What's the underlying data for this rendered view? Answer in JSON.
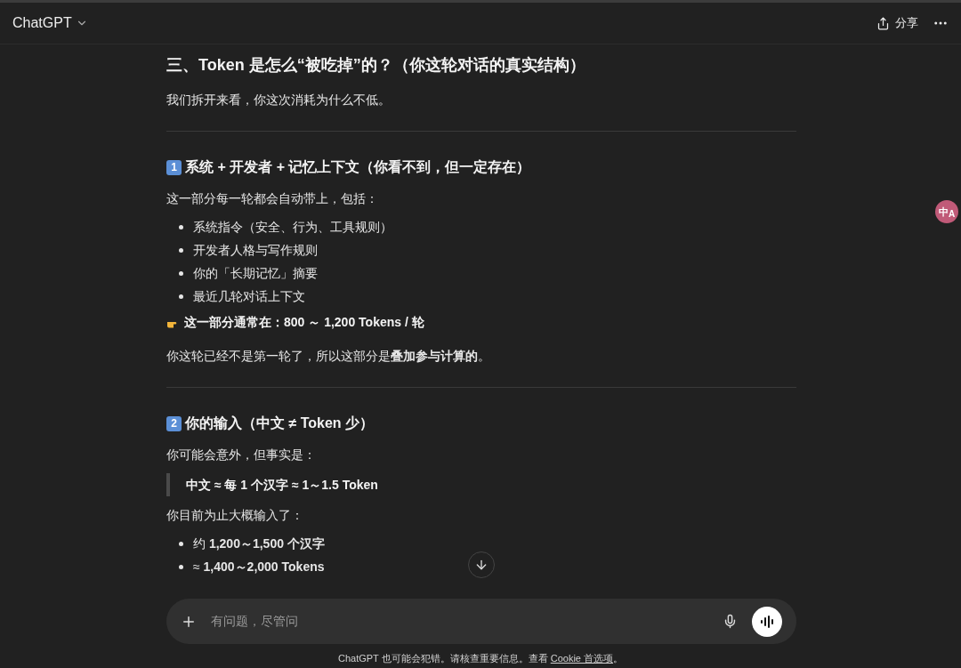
{
  "header": {
    "title": "ChatGPT",
    "share_label": "分享"
  },
  "blocks": [
    {
      "kind": "heading",
      "text": "三、Token 是怎么“被吃掉”的？（你这轮对话的真实结构）"
    },
    {
      "kind": "paragraph",
      "text": "我们拆开来看，你这次消耗为什么不低。"
    },
    {
      "kind": "divider"
    },
    {
      "kind": "subheading",
      "number": "1",
      "text": "系统 + 开发者 + 记忆上下文（你看不到，但一定存在）"
    },
    {
      "kind": "paragraph",
      "text": "这一部分每一轮都会自动带上，包括："
    },
    {
      "kind": "list",
      "items": [
        "系统指令（安全、行为、工具规则）",
        "开发者人格与写作规则",
        "你的「长期记忆」摘要",
        "最近几轮对话上下文"
      ]
    },
    {
      "kind": "callout",
      "text": "这一部分通常在：800 ～ 1,200 Tokens / 轮"
    },
    {
      "kind": "paragraph",
      "text": "你这轮已经不是第一轮了，所以这部分是**叠加参与计算的**。"
    },
    {
      "kind": "divider"
    },
    {
      "kind": "subheading",
      "number": "2",
      "text": "你的输入（中文 ≠ Token 少）"
    },
    {
      "kind": "paragraph",
      "text": "你可能会意外，但事实是："
    },
    {
      "kind": "quote",
      "text": "中文 ≈ 每 1 个汉字 ≈ 1～1.5 Token"
    },
    {
      "kind": "paragraph",
      "text": "你目前为止大概输入了："
    },
    {
      "kind": "list",
      "items": [
        "约 **1,200～1,500 个汉字**",
        "≈ **1,400～2,000 Tokens**"
      ]
    }
  ],
  "composer": {
    "placeholder": "有问题，尽管问"
  },
  "footer": {
    "text": "ChatGPT 也可能会犯错。请核查重要信息。查看 ",
    "link": "Cookie 首选项",
    "end": "。"
  },
  "translate_button": {
    "glyphs": [
      "中",
      "A"
    ]
  }
}
